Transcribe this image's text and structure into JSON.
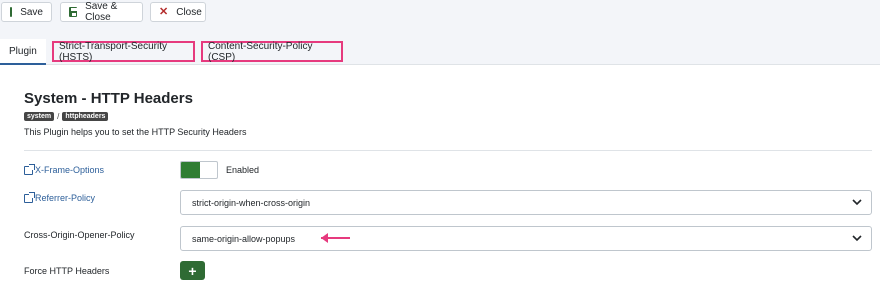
{
  "toolbar": {
    "save_label": "Save",
    "save_close_label": "Save & Close",
    "close_label": "Close"
  },
  "tabs": [
    {
      "label": "Plugin",
      "active": true
    },
    {
      "label": "Strict-Transport-Security (HSTS)",
      "highlighted": true
    },
    {
      "label": "Content-Security-Policy (CSP)",
      "highlighted": true
    }
  ],
  "header": {
    "title": "System - HTTP Headers",
    "breadcrumb": [
      "system",
      "httpheaders"
    ],
    "breadcrumb_separator": "/",
    "description": "This Plugin helps you to set the HTTP Security Headers"
  },
  "form": {
    "x_frame_options": {
      "label": "X-Frame-Options",
      "value": "Enabled"
    },
    "referrer_policy": {
      "label": "Referrer-Policy",
      "value": "strict-origin-when-cross-origin"
    },
    "coop": {
      "label": "Cross-Origin-Opener-Policy",
      "value": "same-origin-allow-popups"
    },
    "force_headers": {
      "label": "Force HTTP Headers",
      "button_symbol": "+"
    }
  },
  "colors": {
    "accent_pink": "#e63a7e",
    "primary_green": "#2f6b34",
    "link_blue": "#2d5f9a"
  }
}
